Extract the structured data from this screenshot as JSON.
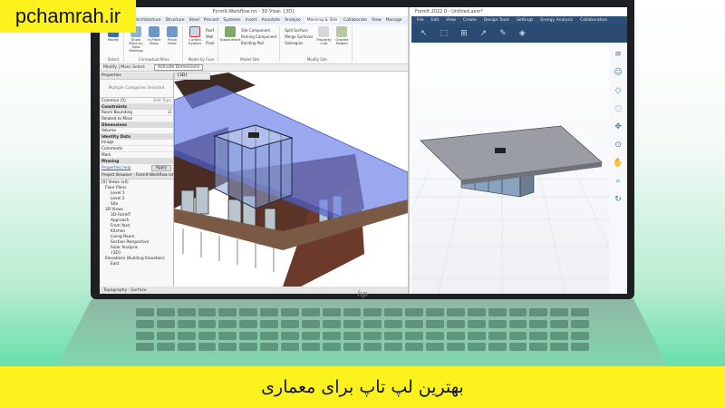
{
  "site_tag": "pchamrah.ir",
  "caption": "بهترین لپ تاپ برای معماری",
  "colors": {
    "banner": "#fbf21d",
    "formit_bar": "#2e4f78",
    "roof_blue": "#6f83e8"
  },
  "laptop_logo": "hp",
  "revit": {
    "window_title": "FormIt-Workflow.rvt - 3D View: {3D}",
    "tabs": [
      "Architecture",
      "Structure",
      "Steel",
      "Precast",
      "Systems",
      "Insert",
      "Annotate",
      "Analyze",
      "Massing & Site",
      "Collaborate",
      "View",
      "Manage"
    ],
    "active_tab": "Massing & Site",
    "ribbon": {
      "conceptual_mass": {
        "label": "Conceptual Mass",
        "buttons": [
          "Modify",
          "Show Mass by View Settings",
          "In-Place Mass",
          "Place Mass"
        ]
      },
      "model_by_face": {
        "label": "Model by Face",
        "buttons": [
          "Curtain System",
          "Roof",
          "Wall",
          "Floor"
        ]
      },
      "model_site": {
        "label": "Model Site",
        "items": [
          "Toposurface",
          "Site Component",
          "Parking Component",
          "Building Pad"
        ]
      },
      "modify_site": {
        "label": "Modify Site",
        "items": [
          "Split Surface",
          "Merge Surfaces",
          "Subregion",
          "Property Line",
          "Graded Region"
        ]
      }
    },
    "select_label": "Select",
    "options_bar": [
      "Modify | Mass Select",
      "Activate Dimensions"
    ],
    "properties": {
      "title": "Properties",
      "type_selector": "Multiple Categories Selected",
      "filter": "Common (5)",
      "edit_type": "Edit Type",
      "groups": [
        {
          "name": "Constraints",
          "rows": [
            {
              "k": "Room Bounding",
              "v": "☑"
            },
            {
              "k": "Related to Mass",
              "v": ""
            }
          ]
        },
        {
          "name": "Dimensions",
          "rows": [
            {
              "k": "Volume",
              "v": ""
            }
          ]
        },
        {
          "name": "Identity Data",
          "rows": [
            {
              "k": "Image",
              "v": ""
            },
            {
              "k": "Comments",
              "v": ""
            },
            {
              "k": "Mark",
              "v": ""
            }
          ]
        },
        {
          "name": "Phasing",
          "rows": []
        }
      ],
      "help_link": "Properties help",
      "apply": "Apply"
    },
    "project_browser": {
      "title": "Project Browser - FormIt-Workflow.rvt",
      "items": [
        "[0] Views (all)",
        "Floor Plans",
        "Level 1",
        "Level 2",
        "Site",
        "3D Views",
        "3D-FormIT",
        "Approach",
        "From Yard",
        "Kitchen",
        "Living Room",
        "Section Perspective",
        "Solar Analysis",
        "{3D}",
        "Elevations (Building Elevation)",
        "East"
      ]
    },
    "view_tab": "{3D}",
    "status": "Topography : Surface"
  },
  "formit": {
    "window_title": "FormIt 2022.0 - Untitled.axm*",
    "menu": [
      "File",
      "Edit",
      "View",
      "Create",
      "Design Tools",
      "Settings",
      "Energy Analysis",
      "Collaboration"
    ],
    "tool_icons": [
      "select-icon",
      "paint-icon",
      "group-icon",
      "layer-icon",
      "pencil-icon",
      "cube-icon"
    ],
    "side_icons": [
      "stack-icon",
      "person-icon",
      "cube-view-icon",
      "orbit-icon",
      "pan-icon",
      "zoom-icon",
      "hand-icon",
      "magnify-icon",
      "rotate-icon"
    ]
  }
}
